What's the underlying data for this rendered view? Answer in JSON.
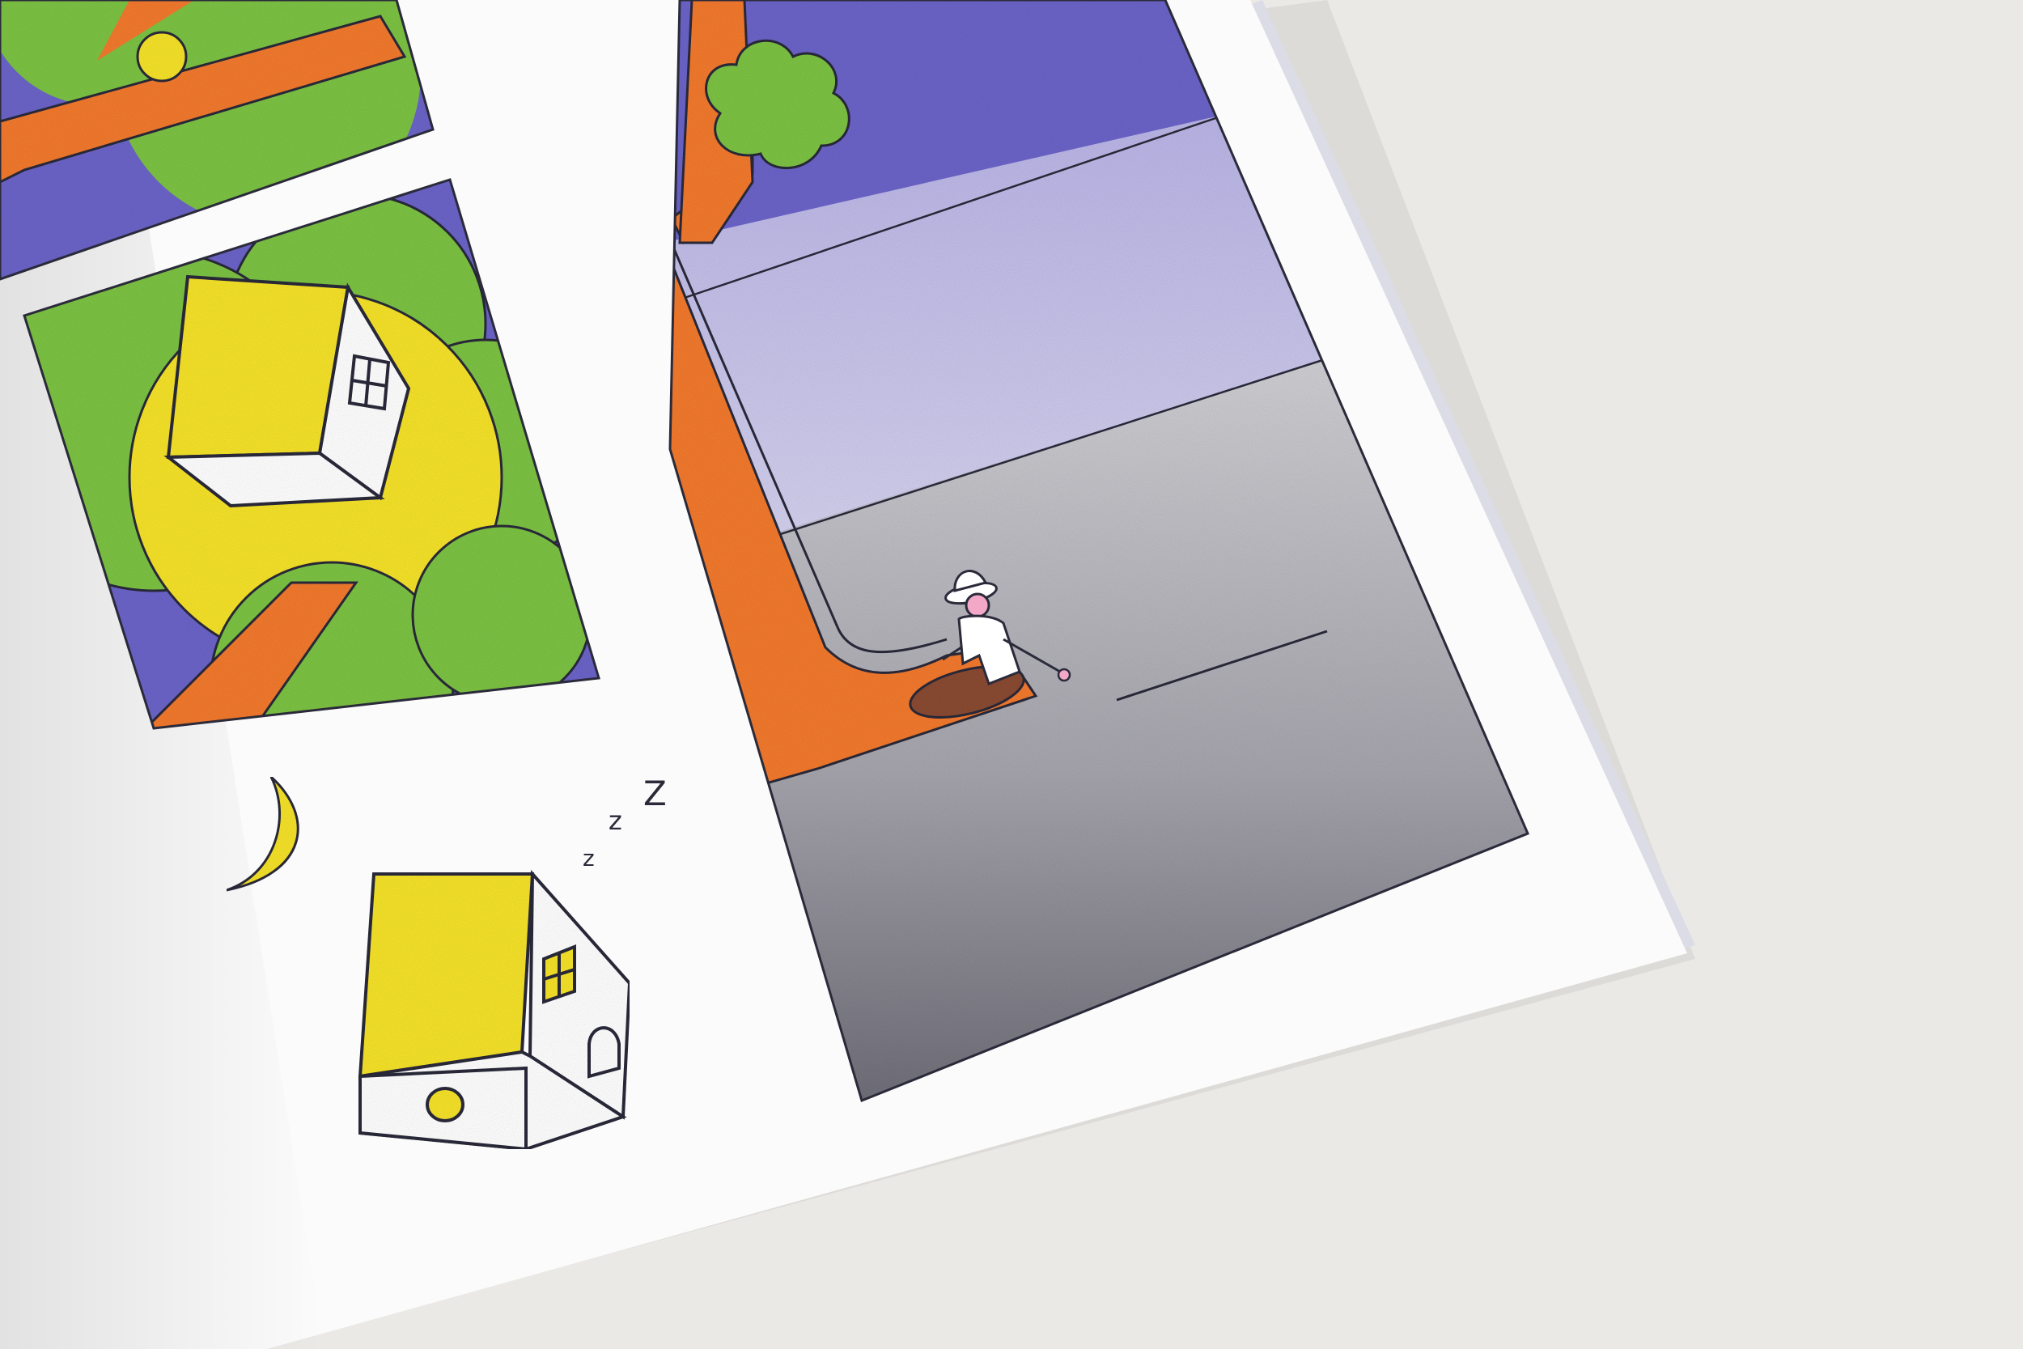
{
  "scene": {
    "subject": "risograph-comic-page",
    "colors": {
      "tabletop": "#ebe9e6",
      "paper": "#fbfbfb",
      "ink": "#2a2a3a",
      "night_sky": "#6b64c8",
      "dusk_band": "#c6c2ea",
      "ground_gray": "#9c9aa4",
      "deep_gray": "#6f6e78",
      "tree_orange": "#f2792e",
      "leaf_green": "#7cc243",
      "house_yellow": "#f5e22a",
      "hole_brown": "#8a4a32"
    },
    "sleep_text": [
      "z",
      "z",
      "Z"
    ]
  }
}
